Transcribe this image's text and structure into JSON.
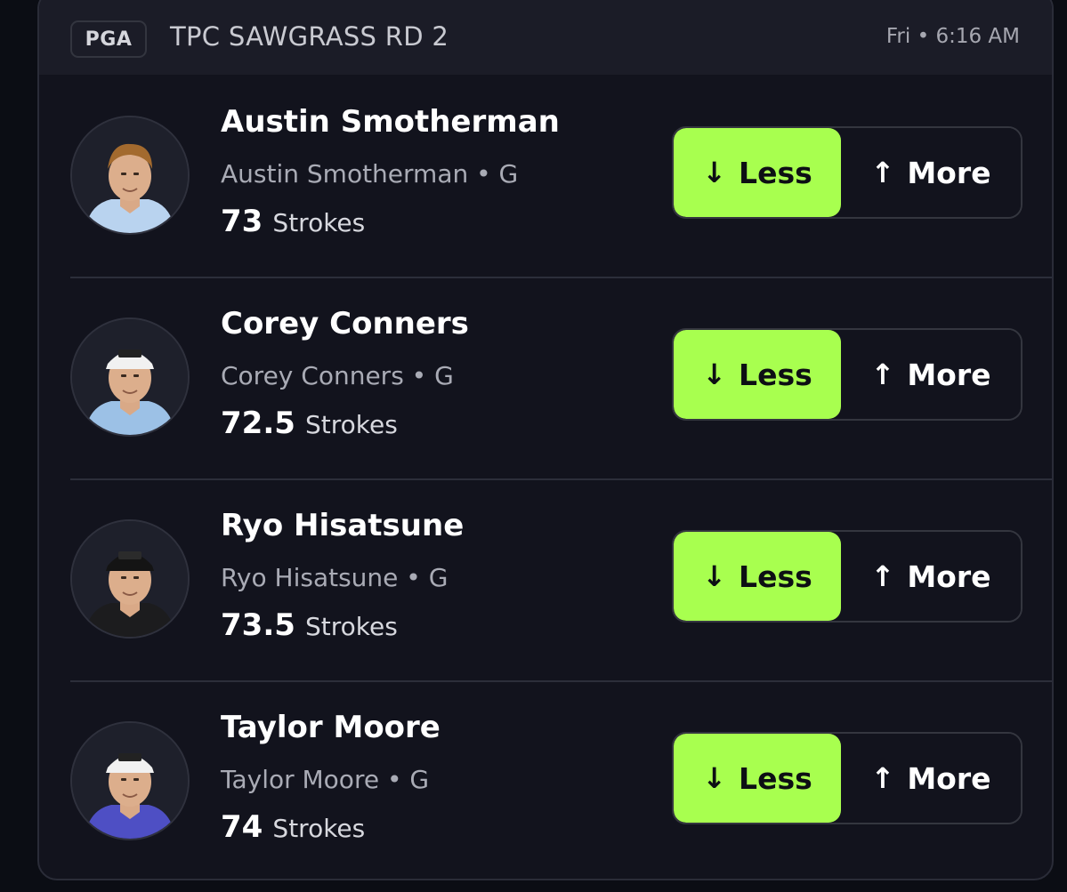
{
  "header": {
    "league": "PGA",
    "event": "TPC SAWGRASS RD 2",
    "time": "Fri • 6:16 AM"
  },
  "buttons": {
    "less_label": "Less",
    "more_label": "More",
    "less_arrow": "↓",
    "more_arrow": "↑"
  },
  "colors": {
    "accent": "#a8ff4f",
    "card_bg": "#12131d",
    "header_bg": "#1b1c27"
  },
  "players": [
    {
      "name": "Austin Smotherman",
      "subtitle": "Austin Smotherman • G",
      "line": "73",
      "unit": "Strokes",
      "selected": "less",
      "avatar": {
        "shirt": "#b9d3ef",
        "hair": "#a36a2e",
        "cap": false,
        "icon": "player-headshot"
      }
    },
    {
      "name": "Corey Conners",
      "subtitle": "Corey Conners • G",
      "line": "72.5",
      "unit": "Strokes",
      "selected": "less",
      "avatar": {
        "shirt": "#9cc1e6",
        "hair": "#4a3322",
        "cap": true,
        "cap_color": "#f1f1f1",
        "icon": "player-headshot"
      }
    },
    {
      "name": "Ryo Hisatsune",
      "subtitle": "Ryo Hisatsune • G",
      "line": "73.5",
      "unit": "Strokes",
      "selected": "less",
      "avatar": {
        "shirt": "#1c1c1e",
        "hair": "#111111",
        "cap": true,
        "cap_color": "#141414",
        "icon": "player-headshot"
      }
    },
    {
      "name": "Taylor Moore",
      "subtitle": "Taylor Moore • G",
      "line": "74",
      "unit": "Strokes",
      "selected": "less",
      "avatar": {
        "shirt": "#4e4fc4",
        "hair": "#5a3d25",
        "cap": true,
        "cap_color": "#f1f1f1",
        "icon": "player-headshot"
      }
    }
  ]
}
